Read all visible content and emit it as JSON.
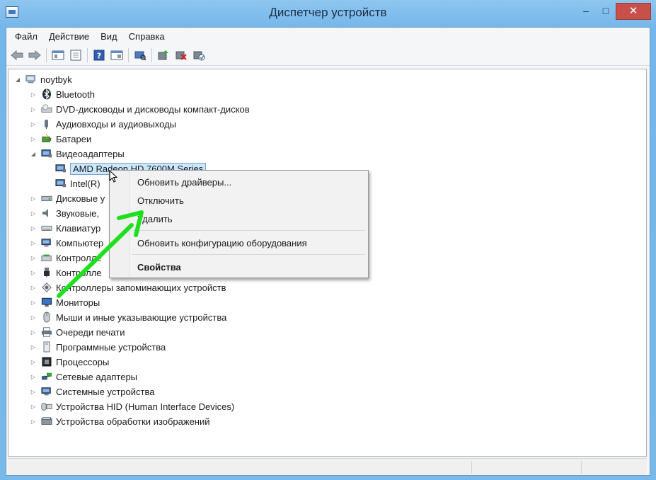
{
  "window": {
    "title": "Диспетчер устройств",
    "minimize_glyph": "–",
    "maximize_glyph": "□",
    "close_glyph": "✕"
  },
  "menu": [
    "Файл",
    "Действие",
    "Вид",
    "Справка"
  ],
  "toolbar_icons": [
    "back-icon",
    "forward-icon",
    "properties-pane-icon",
    "properties-icon",
    "help-icon",
    "view-icon",
    "scan-hardware-icon",
    "update-driver-icon",
    "uninstall-icon",
    "enable-device-icon"
  ],
  "tree": {
    "root": "noytbyk",
    "items": [
      {
        "label": "Bluetooth",
        "icon": "bluetooth-icon",
        "expanded": false
      },
      {
        "label": "DVD-дисководы и дисководы компакт-дисков",
        "icon": "dvd-drive-icon",
        "expanded": false
      },
      {
        "label": "Аудиовходы и аудиовыходы",
        "icon": "audio-icon",
        "expanded": false
      },
      {
        "label": "Батареи",
        "icon": "battery-icon",
        "expanded": false
      },
      {
        "label": "Видеоадаптеры",
        "icon": "display-adapter-icon",
        "expanded": true
      },
      {
        "label": "AMD Radeon HD 7600M Series",
        "icon": "display-adapter-icon",
        "child": true,
        "selected": true
      },
      {
        "label": "Intel(R)",
        "icon": "display-adapter-icon",
        "child": true
      },
      {
        "label": "Дисковые у",
        "icon": "disk-drive-icon",
        "expanded": false
      },
      {
        "label": "Звуковые,",
        "icon": "sound-icon",
        "expanded": false
      },
      {
        "label": "Клавиатур",
        "icon": "keyboard-icon",
        "expanded": false
      },
      {
        "label": "Компьютер",
        "icon": "computer-icon",
        "expanded": false
      },
      {
        "label": "Контролле",
        "icon": "controller-icon",
        "expanded": false
      },
      {
        "label": "Контролле",
        "icon": "usb-controller-icon",
        "expanded": false
      },
      {
        "label": "Контроллеры запоминающих устройств",
        "icon": "storage-controller-icon",
        "expanded": false
      },
      {
        "label": "Мониторы",
        "icon": "monitor-icon",
        "expanded": false
      },
      {
        "label": "Мыши и иные указывающие устройства",
        "icon": "mouse-icon",
        "expanded": false
      },
      {
        "label": "Очереди печати",
        "icon": "printer-icon",
        "expanded": false
      },
      {
        "label": "Программные устройства",
        "icon": "software-device-icon",
        "expanded": false
      },
      {
        "label": "Процессоры",
        "icon": "processor-icon",
        "expanded": false
      },
      {
        "label": "Сетевые адаптеры",
        "icon": "network-adapter-icon",
        "expanded": false
      },
      {
        "label": "Системные устройства",
        "icon": "system-device-icon",
        "expanded": false
      },
      {
        "label": "Устройства HID (Human Interface Devices)",
        "icon": "hid-icon",
        "expanded": false
      },
      {
        "label": "Устройства обработки изображений",
        "icon": "imaging-device-icon",
        "expanded": false
      }
    ]
  },
  "context_menu": {
    "update_driver": "Обновить драйверы...",
    "disable": "Отключить",
    "uninstall": "Удалить",
    "scan_hardware": "Обновить конфигурацию оборудования",
    "properties": "Свойства"
  },
  "colors": {
    "arrow": "#1fe01f",
    "selection": "#cce8ff",
    "close_button": "#c7504a"
  }
}
